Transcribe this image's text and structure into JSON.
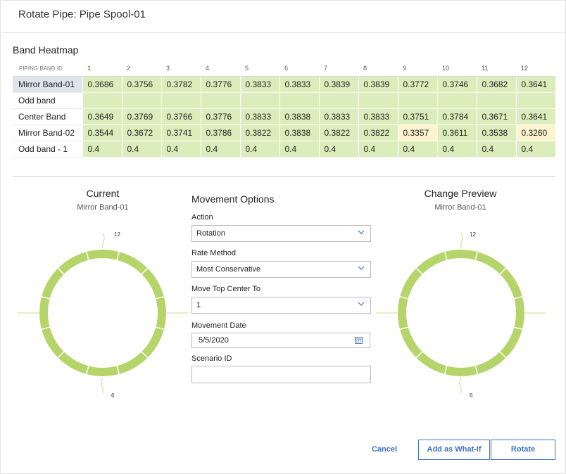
{
  "dialog": {
    "title": "Rotate Pipe: Pipe Spool-01"
  },
  "heatmap": {
    "title": "Band Heatmap",
    "header_band": "PIPING BAND ID",
    "columns": [
      "1",
      "2",
      "3",
      "4",
      "5",
      "6",
      "7",
      "8",
      "9",
      "10",
      "11",
      "12"
    ],
    "rows": [
      {
        "name": "Mirror Band-01",
        "selected": true,
        "values": [
          "0.3686",
          "0.3756",
          "0.3782",
          "0.3776",
          "0.3833",
          "0.3833",
          "0.3839",
          "0.3839",
          "0.3772",
          "0.3746",
          "0.3682",
          "0.3641"
        ]
      },
      {
        "name": "Odd band",
        "selected": false,
        "values": [
          "",
          "",
          "",
          "",
          "",
          "",
          "",
          "",
          "",
          "",
          "",
          ""
        ]
      },
      {
        "name": "Center Band",
        "selected": false,
        "values": [
          "0.3649",
          "0.3769",
          "0.3766",
          "0.3776",
          "0.3833",
          "0.3838",
          "0.3833",
          "0.3833",
          "0.3751",
          "0.3784",
          "0.3671",
          "0.3641"
        ]
      },
      {
        "name": "Mirror Band-02",
        "selected": false,
        "values": [
          "0.3544",
          "0.3672",
          "0.3741",
          "0.3786",
          "0.3822",
          "0.3838",
          "0.3822",
          "0.3822",
          "0.3357",
          "0.3611",
          "0.3538",
          "0.3260"
        ],
        "warn_columns": [
          8,
          11
        ]
      },
      {
        "name": "Odd band - 1",
        "selected": false,
        "values": [
          "0.4",
          "0.4",
          "0.4",
          "0.4",
          "0.4",
          "0.4",
          "0.4",
          "0.4",
          "0.4",
          "0.4",
          "0.4",
          "0.4"
        ]
      }
    ],
    "colors": {
      "ok": "#dcedbc",
      "warn": "#fdf3cf",
      "selected": "#dde4ec"
    }
  },
  "current": {
    "title": "Current",
    "band": "Mirror Band-01",
    "top_label": "12",
    "bottom_label": "6"
  },
  "preview": {
    "title": "Change Preview",
    "band": "Mirror Band-01",
    "top_label": "12",
    "bottom_label": "6"
  },
  "ring_color": "#b5d56a",
  "movement": {
    "title": "Movement Options",
    "action_label": "Action",
    "action_value": "Rotation",
    "rate_label": "Rate Method",
    "rate_value": "Most Conservative",
    "move_label": "Move Top Center To",
    "move_value": "1",
    "date_label": "Movement Date",
    "date_value": "5/5/2020",
    "scenario_label": "Scenario ID",
    "scenario_value": ""
  },
  "buttons": {
    "cancel": "Cancel",
    "what_if": "Add as What-If",
    "rotate": "Rotate"
  },
  "icons": {
    "chevron": "chevron-down-icon",
    "calendar": "calendar-icon"
  }
}
